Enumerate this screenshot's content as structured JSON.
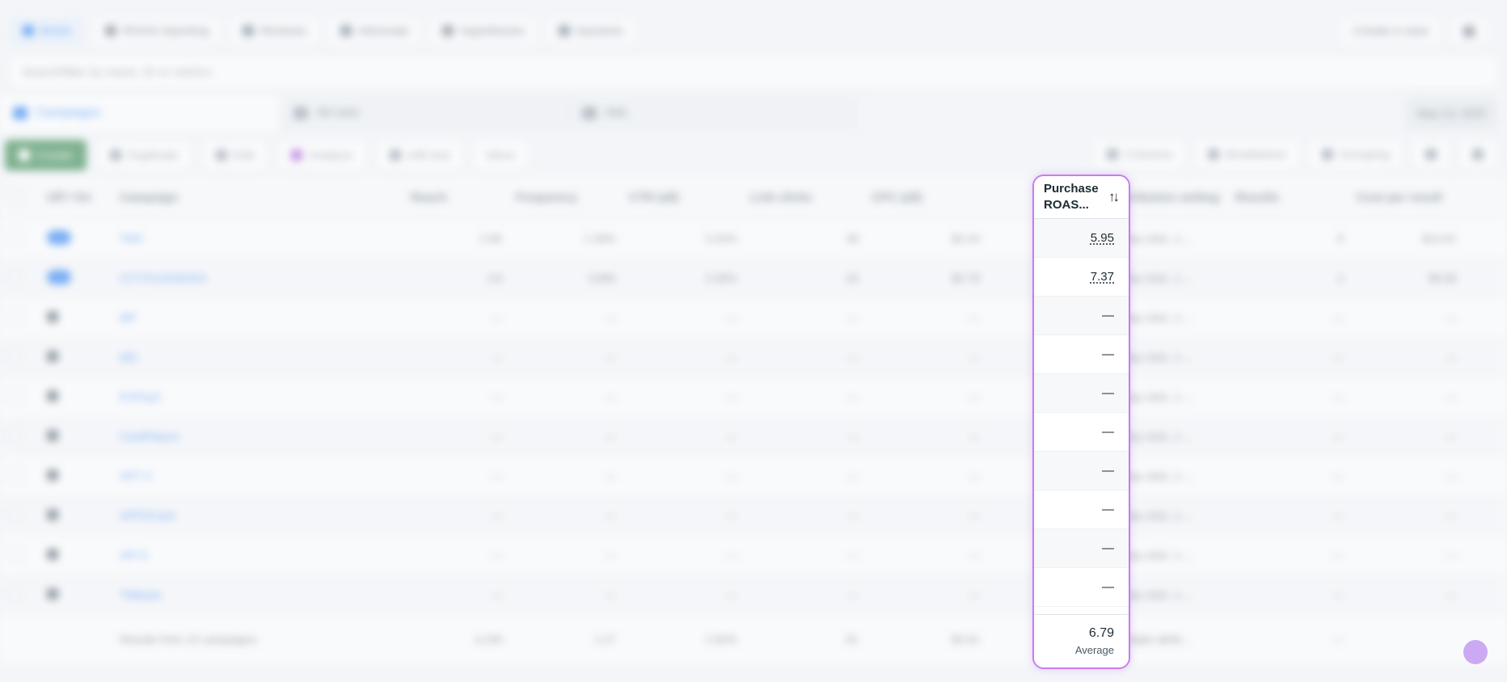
{
  "topbar": {
    "tabs": [
      {
        "label": "Briefs",
        "active": true
      },
      {
        "label": "ROAS reporting",
        "active": false
      },
      {
        "label": "Reviews",
        "active": false
      },
      {
        "label": "Advocate",
        "active": false
      },
      {
        "label": "Hypotheses",
        "active": false
      },
      {
        "label": "Dynamic",
        "active": false
      }
    ],
    "right_action": "Create a view"
  },
  "search": {
    "placeholder": "Search/filter by name, ID or metrics"
  },
  "level_tabs": [
    {
      "label": "Campaigns",
      "active": true
    },
    {
      "label": "Ad sets",
      "active": false
    },
    {
      "label": "Ads",
      "active": false
    }
  ],
  "date_range": "May 13, 2025",
  "toolbar": {
    "create": "Create",
    "duplicate": "Duplicate",
    "edit": "Edit",
    "analyze": "Analyze",
    "ab_test": "A/B test",
    "more": "More",
    "columns": "Columns",
    "breakdown": "Breakdown",
    "grouping": "Grouping"
  },
  "table": {
    "headers": [
      "Off / On",
      "Campaign",
      "Reach",
      "Frequency",
      "CTR (all)",
      "Link clicks",
      "CPC (all)",
      "Attribution setting",
      "Results",
      "Cost per result"
    ],
    "rows": [
      {
        "on": true,
        "name": "TMC",
        "reach": "2.8K",
        "freq": "1.09%",
        "ctr": "1.16",
        "link": "3.20%",
        "clicks": "38",
        "cpc": "$2.24",
        "attr": "7-day click, 1-...",
        "results": "8",
        "cost": "$14.61"
      },
      {
        "on": true,
        "name": "CCT/AUSSIE/EN",
        "reach": "3.6",
        "freq": "3,860",
        "ctr": "1.01",
        "link": "2.58%",
        "clicks": "43",
        "cpc": "$0.78",
        "attr": "7-day click, 1-...",
        "results": "2",
        "cost": "$9.88"
      },
      {
        "on": false,
        "name": "MP",
        "reach": "—",
        "freq": "—",
        "ctr": "—",
        "link": "—",
        "clicks": "—",
        "cpc": "—",
        "attr": "7-day click, 1-...",
        "results": "—",
        "cost": "—"
      },
      {
        "on": false,
        "name": "MD",
        "reach": "—",
        "freq": "—",
        "ctr": "—",
        "link": "—",
        "clicks": "—",
        "cpc": "—",
        "attr": "7-day click, 1-...",
        "results": "—",
        "cost": "—"
      },
      {
        "on": false,
        "name": "EVPay3",
        "reach": "—",
        "freq": "—",
        "ctr": "—",
        "link": "—",
        "clicks": "—",
        "cpc": "—",
        "attr": "7-day click, 1-...",
        "results": "—",
        "cost": "—"
      },
      {
        "on": false,
        "name": "CardPlatum",
        "reach": "—",
        "freq": "—",
        "ctr": "—",
        "link": "—",
        "clicks": "—",
        "cpc": "—",
        "attr": "7-day click, 1-...",
        "results": "—",
        "cost": "—"
      },
      {
        "on": false,
        "name": "APT 3",
        "reach": "—",
        "freq": "—",
        "ctr": "—",
        "link": "—",
        "clicks": "—",
        "cpc": "—",
        "attr": "7-day click, 1-...",
        "results": "—",
        "cost": "—"
      },
      {
        "on": false,
        "name": "APFDCard",
        "reach": "—",
        "freq": "—",
        "ctr": "—",
        "link": "—",
        "clicks": "—",
        "cpc": "—",
        "attr": "7-day click, 1-...",
        "results": "—",
        "cost": "—"
      },
      {
        "on": false,
        "name": "API 5",
        "reach": "—",
        "freq": "—",
        "ctr": "—",
        "link": "—",
        "clicks": "—",
        "cpc": "—",
        "attr": "7-day click, 1-...",
        "results": "—",
        "cost": "—"
      },
      {
        "on": false,
        "name": "TMbasic",
        "reach": "—",
        "freq": "—",
        "ctr": "—",
        "link": "—",
        "clicks": "—",
        "cpc": "—",
        "attr": "7-day click, 1-...",
        "results": "—",
        "cost": "—"
      }
    ],
    "footer": {
      "label": "Results from 10 campaigns",
      "reach": "4,230",
      "freq": "1.27",
      "ctr": "2.82%",
      "clicks": "81",
      "cpc": "$2.61",
      "attr": "Multiple attrib...",
      "results": "—"
    }
  },
  "highlight": {
    "title": "Purchase ROAS...",
    "sort_icon": "sort-arrows-icon",
    "cells": [
      "5.95",
      "7.37",
      "—",
      "—",
      "—",
      "—",
      "—",
      "—",
      "—",
      "—"
    ],
    "footer_value": "6.79",
    "footer_label": "Average"
  },
  "colors": {
    "highlight_border": "#c77dec",
    "accent": "#1877f2",
    "create_btn": "#1f7a3a"
  }
}
